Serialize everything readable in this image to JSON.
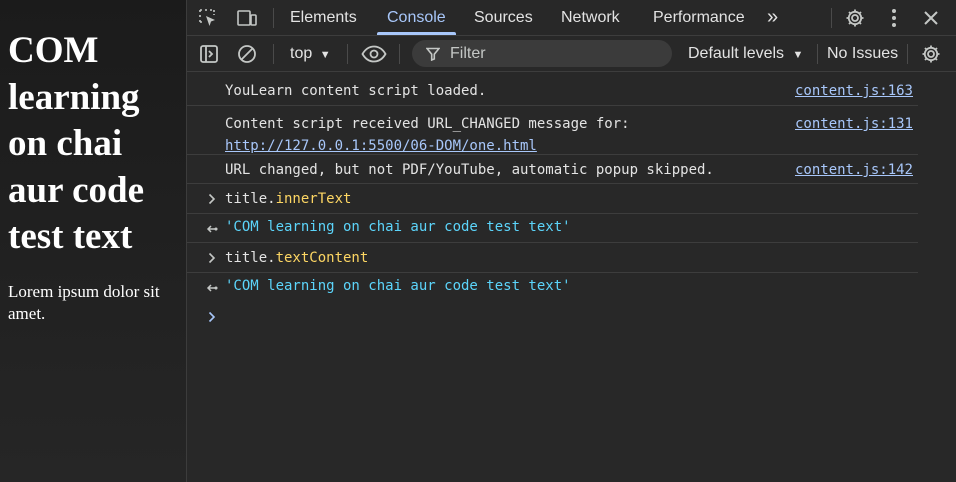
{
  "page": {
    "heading": "COM learning on chai aur code test text",
    "paragraph": "Lorem ipsum dolor sit amet."
  },
  "devtools": {
    "tabs": [
      {
        "label": "Elements"
      },
      {
        "label": "Console"
      },
      {
        "label": "Sources"
      },
      {
        "label": "Network"
      },
      {
        "label": "Performance"
      }
    ],
    "more_tabs": "»",
    "toolbar": {
      "context": "top",
      "filter_placeholder": "Filter",
      "levels": "Default levels",
      "issues": "No Issues"
    },
    "icons": [
      "inspect-element-icon",
      "device-toolbar-icon",
      "settings-icon",
      "kebab-menu-icon",
      "close-icon",
      "sidebar-toggle-icon",
      "clear-console-icon",
      "live-expression-eye-icon",
      "filter-icon",
      "settings-gear-icon"
    ],
    "colors": {
      "accent": "#a8c7fa",
      "property": "#fdd663",
      "string": "#5cd5fb",
      "text": "#e3e3e3"
    }
  },
  "console": {
    "logs": [
      {
        "text": "YouLearn content script loaded.",
        "source": "content.js:163"
      },
      {
        "text": "Content script received URL_CHANGED message for:",
        "link": "http://127.0.0.1:5500/06-DOM/one.html",
        "source": "content.js:131"
      },
      {
        "text": "URL changed, but not PDF/YouTube, automatic popup skipped.",
        "source": "content.js:142"
      }
    ],
    "entries": [
      {
        "object": "title.",
        "property": "innerText"
      },
      {
        "result": "'COM learning on chai aur code test text'"
      },
      {
        "object": "title.",
        "property": "textContent"
      },
      {
        "result": "'COM learning on chai aur code test text'"
      }
    ]
  }
}
